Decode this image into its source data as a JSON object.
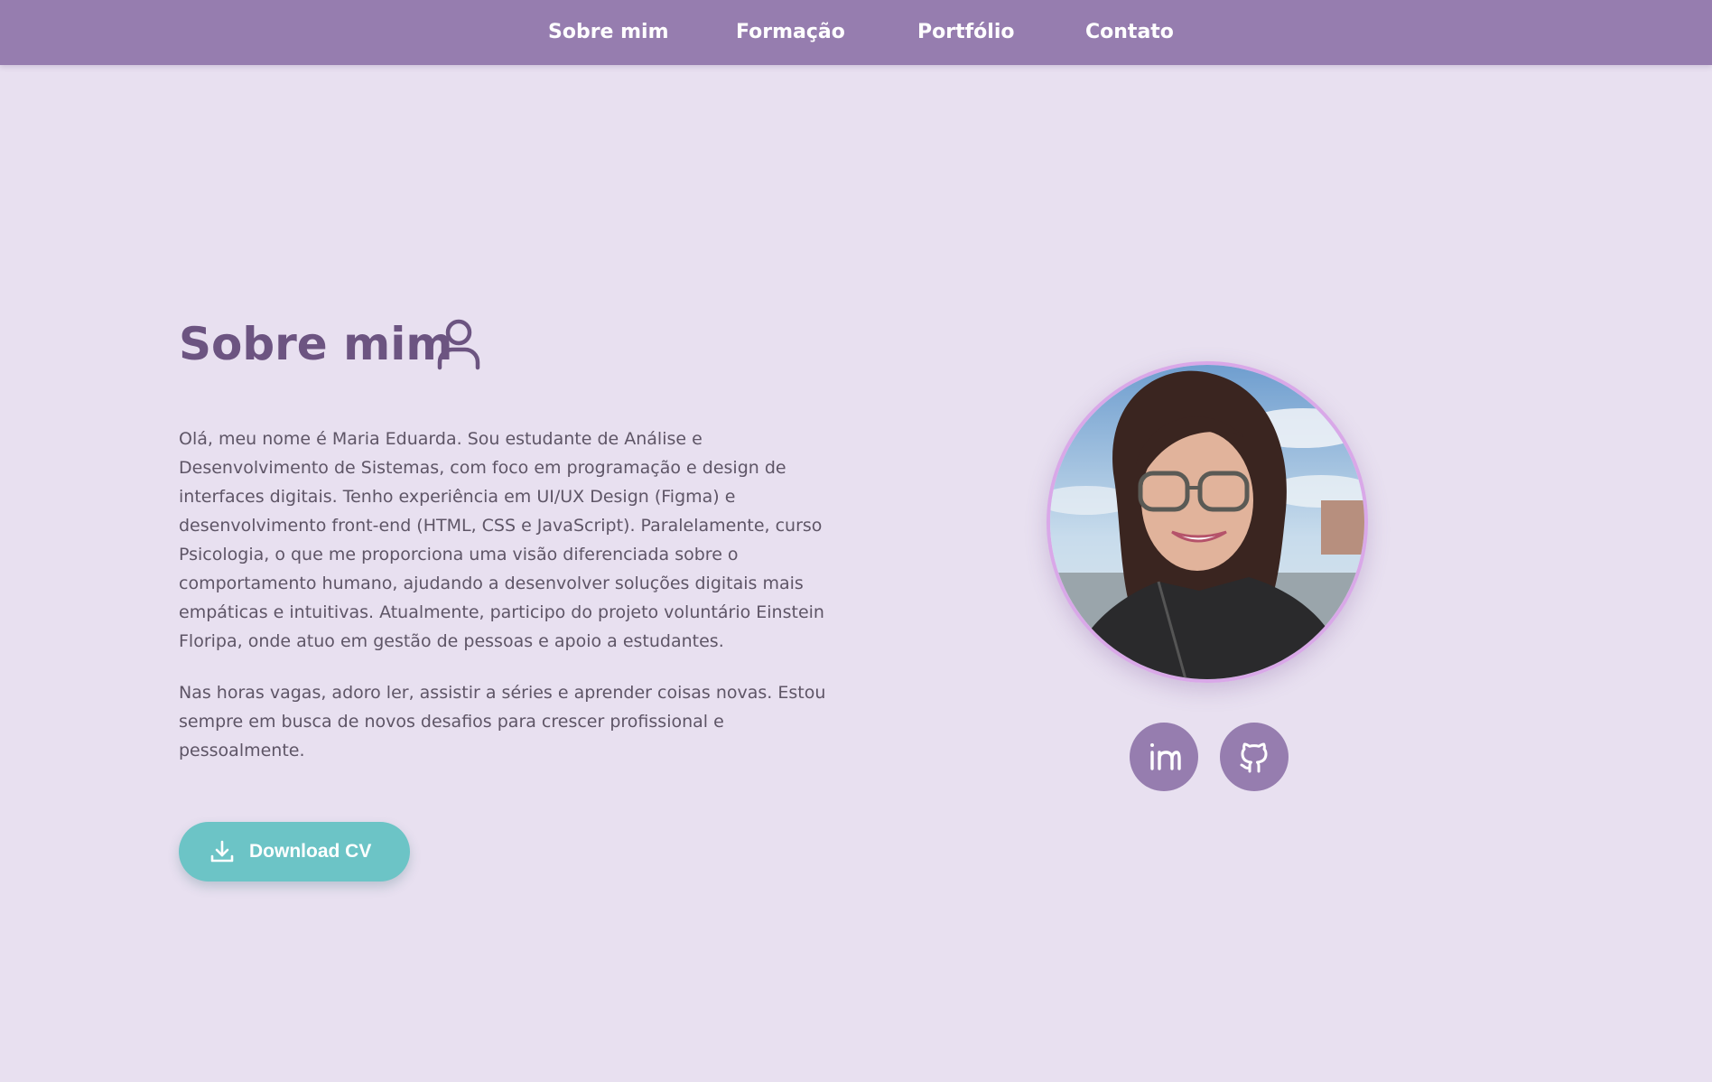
{
  "nav": {
    "items": [
      {
        "label": "Sobre mim"
      },
      {
        "label": "Formação"
      },
      {
        "label": "Portfólio"
      },
      {
        "label": "Contato"
      }
    ]
  },
  "about": {
    "title": "Sobre mim",
    "title_icon": "user-icon",
    "paragraphs": [
      "Olá, meu nome é Maria Eduarda. Sou estudante de Análise e Desenvolvimento de Sistemas, com foco em programação e design de interfaces digitais. Tenho experiência em UI/UX Design (Figma) e desenvolvimento front-end (HTML, CSS e JavaScript). Paralelamente, curso Psicologia, o que me proporciona uma visão diferenciada sobre o comportamento humano, ajudando a desenvolver soluções digitais mais empáticas e intuitivas. Atualmente, participo do projeto voluntário Einstein Floripa, onde atuo em gestão de pessoas e apoio a estudantes.",
      "Nas horas vagas, adoro ler, assistir a séries e aprender coisas novas. Estou sempre em busca de novos desafios para crescer profissional e pessoalmente."
    ],
    "download_button": {
      "label": "Download CV",
      "icon": "download-icon"
    }
  },
  "profile": {
    "photo": "profile-photo",
    "social": [
      {
        "icon": "linkedin-icon"
      },
      {
        "icon": "github-icon"
      }
    ]
  },
  "colors": {
    "navbar": "#967daf",
    "background": "#e8e0f0",
    "title": "#6c5481",
    "body_text": "#5e5566",
    "button": "#6cc4c6",
    "avatar_border": "#d9a8e8",
    "social_button": "#967daf"
  }
}
